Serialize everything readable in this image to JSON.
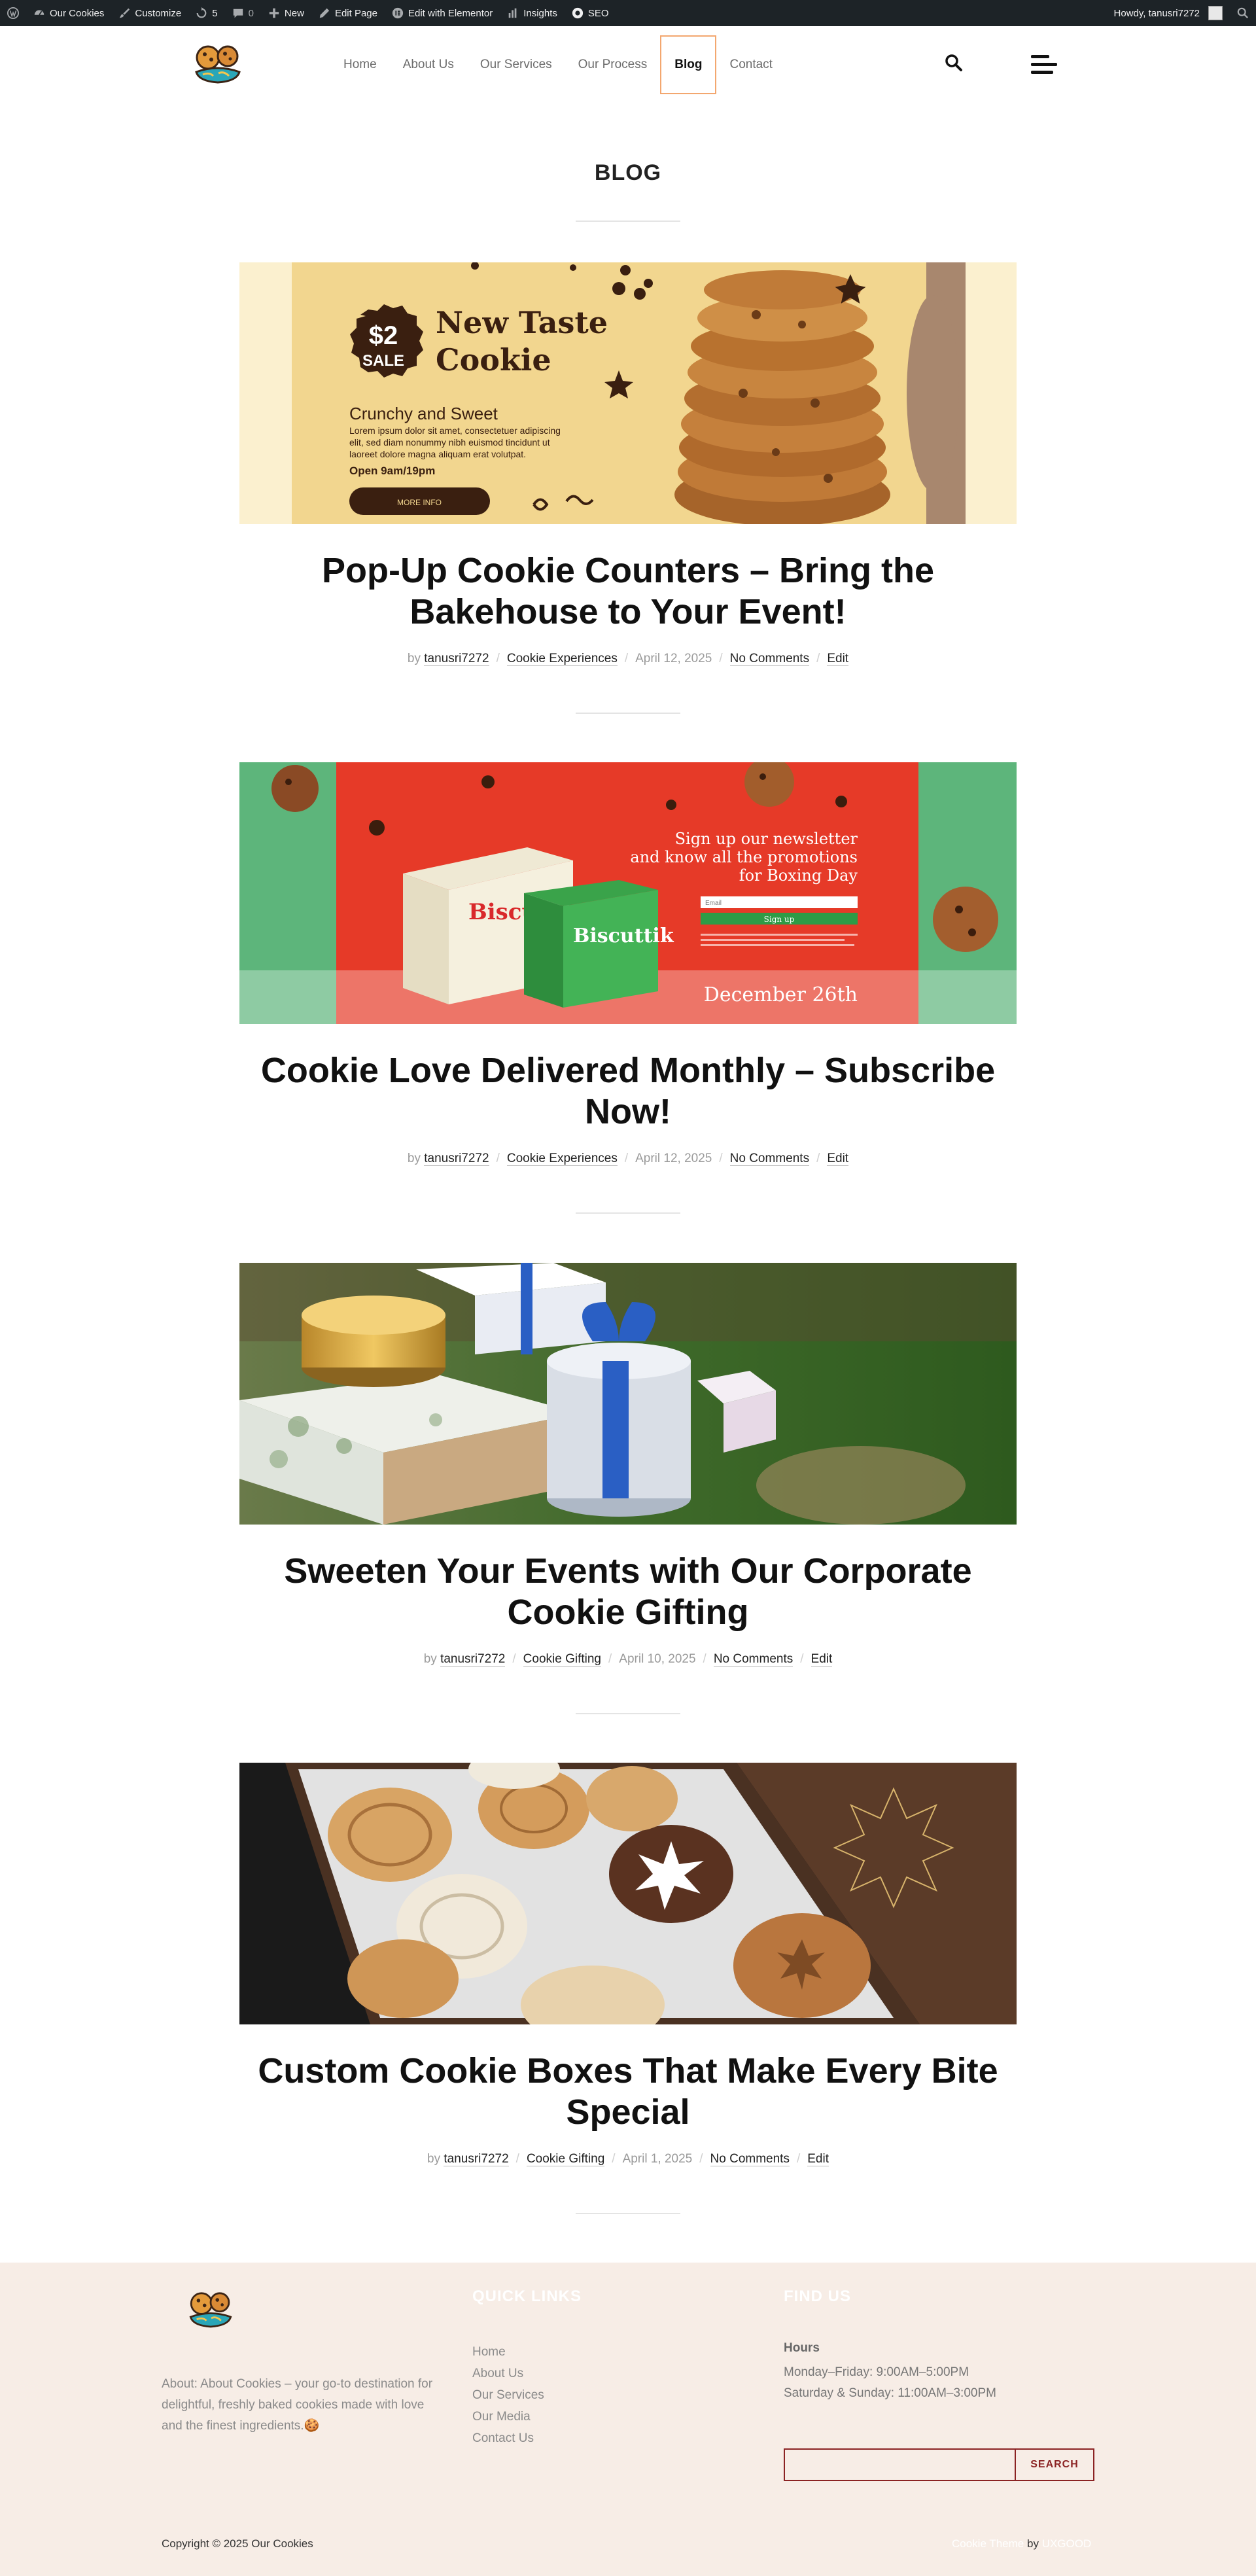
{
  "adminbar": {
    "site_name": "Our Cookies",
    "customize": "Customize",
    "updates_count": "5",
    "comments_count": "0",
    "new": "New",
    "edit_page": "Edit Page",
    "edit_elementor": "Edit with Elementor",
    "insights": "Insights",
    "seo": "SEO",
    "howdy": "Howdy, tanusri7272"
  },
  "nav": {
    "items": [
      {
        "label": "Home"
      },
      {
        "label": "About Us"
      },
      {
        "label": "Our Services"
      },
      {
        "label": "Our Process"
      },
      {
        "label": "Blog",
        "active": true
      },
      {
        "label": "Contact"
      }
    ]
  },
  "page": {
    "title": "BLOG"
  },
  "posts": [
    {
      "title": "Pop-Up Cookie Counters – Bring the Bakehouse to Your Event!",
      "author": "tanusri7272",
      "category": "Cookie Experiences",
      "date": "April 12, 2025",
      "comments": "No Comments",
      "edit": "Edit",
      "by": "by",
      "image": {
        "badge_price": "$2",
        "badge_sale": "SALE",
        "headline_1": "New Taste",
        "headline_2": "Cookie",
        "sub": "Crunchy and Sweet",
        "body_1": "Lorem ipsum dolor sit amet, consectetuer adipiscing",
        "body_2": "elit, sed diam nonummy nibh euismod tincidunt ut",
        "body_3": "laoreet dolore magna aliquam erat volutpat.",
        "hours": "Open 9am/19pm",
        "button": "MORE INFO"
      }
    },
    {
      "title": "Cookie Love Delivered Monthly – Subscribe Now!",
      "author": "tanusri7272",
      "category": "Cookie Experiences",
      "date": "April 12, 2025",
      "comments": "No Comments",
      "edit": "Edit",
      "by": "by",
      "image": {
        "line_1": "Sign up our newsletter",
        "line_2": "and know all the promotions",
        "line_3": "for Boxing Day",
        "email_placeholder": "Email",
        "signup": "Sign up",
        "brand": "Biscuttik",
        "date": "December 26th"
      }
    },
    {
      "title": "Sweeten Your Events with Our Corporate Cookie Gifting",
      "author": "tanusri7272",
      "category": "Cookie Gifting",
      "date": "April 10, 2025",
      "comments": "No Comments",
      "edit": "Edit",
      "by": "by"
    },
    {
      "title": "Custom Cookie Boxes That Make Every Bite Special",
      "author": "tanusri7272",
      "category": "Cookie Gifting",
      "date": "April 1, 2025",
      "comments": "No Comments",
      "edit": "Edit",
      "by": "by"
    }
  ],
  "footer": {
    "about": "About: About Cookies – your go-to destination for delightful, freshly baked cookies made with love and the finest ingredients.🍪",
    "quick_links_heading": "QUICK LINKS",
    "quick_links": [
      "Home",
      "About Us",
      "Our Services",
      "Our Media",
      "Contact Us"
    ],
    "find_us_heading": "FIND US",
    "hours_heading": "Hours",
    "hours": [
      "Monday–Friday: 9:00AM–5:00PM",
      "Saturday & Sunday: 11:00AM–3:00PM"
    ],
    "search_button": "SEARCH",
    "copyright": "Copyright © 2025 Our Cookies",
    "credit_prefix": "Cookie Theme",
    "credit_by": "by",
    "credit_name": "UXGOOD"
  }
}
